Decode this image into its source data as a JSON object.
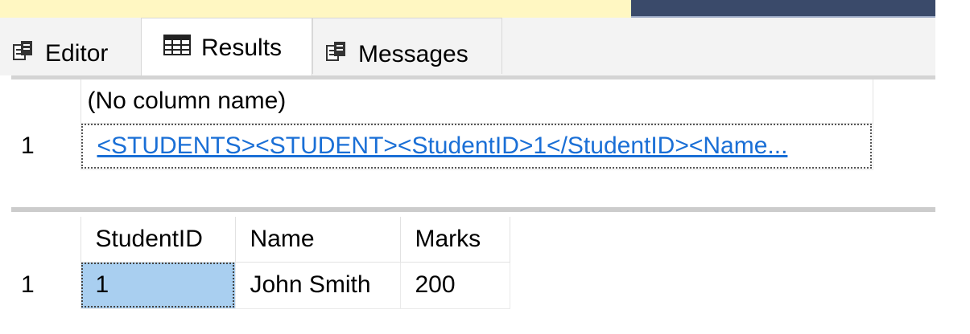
{
  "tabs": [
    {
      "label": "Editor",
      "icon": "editor-icon"
    },
    {
      "label": "Results",
      "icon": "grid-icon"
    },
    {
      "label": "Messages",
      "icon": "messages-icon"
    }
  ],
  "result1": {
    "header": "(No column name)",
    "row_number": "1",
    "value": "<STUDENTS><STUDENT><StudentID>1</StudentID><Name..."
  },
  "result2": {
    "headers": [
      "StudentID",
      "Name",
      "Marks"
    ],
    "rows": [
      {
        "row_number": "1",
        "cells": [
          "1",
          "John Smith",
          "200"
        ]
      }
    ]
  },
  "colors": {
    "link": "#1a6fd6",
    "selection": "#a9cff0",
    "editor_background": "#fff7c2"
  }
}
